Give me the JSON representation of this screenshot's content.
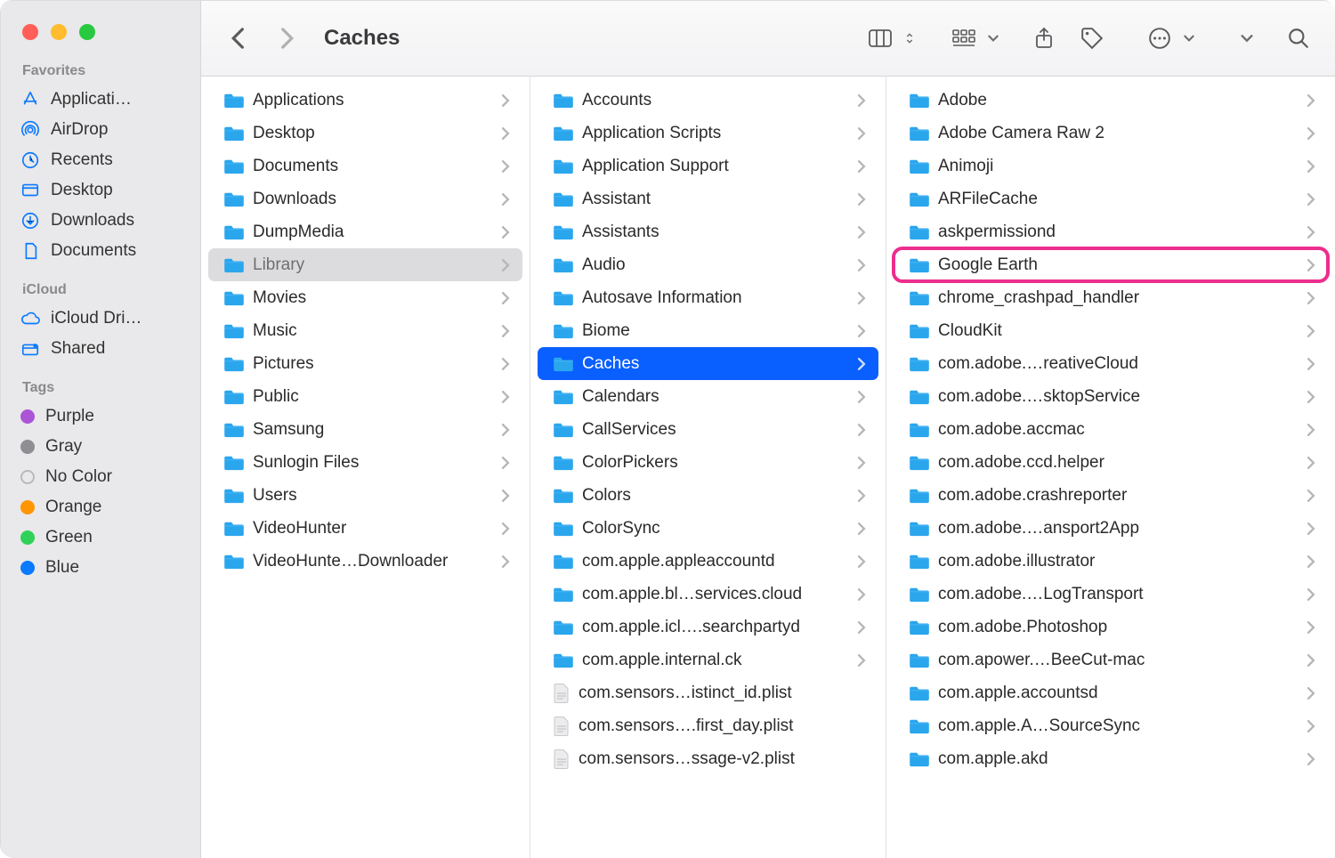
{
  "window_title": "Caches",
  "traffic_lights": [
    "close",
    "minimize",
    "zoom"
  ],
  "sidebar": {
    "sections": [
      {
        "heading": "Favorites",
        "items": [
          {
            "icon": "app-store",
            "label": "Applicati…"
          },
          {
            "icon": "airdrop",
            "label": "AirDrop"
          },
          {
            "icon": "clock",
            "label": "Recents"
          },
          {
            "icon": "desktop",
            "label": "Desktop"
          },
          {
            "icon": "download",
            "label": "Downloads"
          },
          {
            "icon": "document",
            "label": "Documents"
          }
        ]
      },
      {
        "heading": "iCloud",
        "items": [
          {
            "icon": "cloud",
            "label": "iCloud Dri…"
          },
          {
            "icon": "shared",
            "label": "Shared"
          }
        ]
      },
      {
        "heading": "Tags",
        "items": [
          {
            "tag": "#ab54d6",
            "label": "Purple"
          },
          {
            "tag": "#8e8e93",
            "label": "Gray"
          },
          {
            "tag": "none",
            "label": "No Color"
          },
          {
            "tag": "#ff9500",
            "label": "Orange"
          },
          {
            "tag": "#30d158",
            "label": "Green"
          },
          {
            "tag": "#0a7aff",
            "label": "Blue"
          }
        ]
      }
    ]
  },
  "columns": [
    {
      "items": [
        {
          "type": "folder",
          "name": "Applications"
        },
        {
          "type": "folder",
          "name": "Desktop"
        },
        {
          "type": "folder",
          "name": "Documents"
        },
        {
          "type": "folder",
          "name": "Downloads"
        },
        {
          "type": "folder",
          "name": "DumpMedia"
        },
        {
          "type": "folder",
          "name": "Library",
          "selected": "dim"
        },
        {
          "type": "folder",
          "name": "Movies"
        },
        {
          "type": "folder",
          "name": "Music"
        },
        {
          "type": "folder",
          "name": "Pictures"
        },
        {
          "type": "folder",
          "name": "Public"
        },
        {
          "type": "folder",
          "name": "Samsung"
        },
        {
          "type": "folder",
          "name": "Sunlogin Files"
        },
        {
          "type": "folder",
          "name": "Users"
        },
        {
          "type": "folder",
          "name": "VideoHunter"
        },
        {
          "type": "folder",
          "name": "VideoHunte…Downloader"
        }
      ]
    },
    {
      "items": [
        {
          "type": "folder",
          "name": "Accounts"
        },
        {
          "type": "folder",
          "name": "Application Scripts"
        },
        {
          "type": "folder",
          "name": "Application Support"
        },
        {
          "type": "folder",
          "name": "Assistant"
        },
        {
          "type": "folder",
          "name": "Assistants"
        },
        {
          "type": "folder",
          "name": "Audio"
        },
        {
          "type": "folder",
          "name": "Autosave Information"
        },
        {
          "type": "folder",
          "name": "Biome"
        },
        {
          "type": "folder",
          "name": "Caches",
          "selected": "blue"
        },
        {
          "type": "folder",
          "name": "Calendars"
        },
        {
          "type": "folder",
          "name": "CallServices"
        },
        {
          "type": "folder",
          "name": "ColorPickers"
        },
        {
          "type": "folder",
          "name": "Colors"
        },
        {
          "type": "folder",
          "name": "ColorSync"
        },
        {
          "type": "folder",
          "name": "com.apple.appleaccountd"
        },
        {
          "type": "folder",
          "name": "com.apple.bl…services.cloud"
        },
        {
          "type": "folder",
          "name": "com.apple.icl….searchpartyd"
        },
        {
          "type": "folder",
          "name": "com.apple.internal.ck"
        },
        {
          "type": "file",
          "name": "com.sensors…istinct_id.plist"
        },
        {
          "type": "file",
          "name": "com.sensors….first_day.plist"
        },
        {
          "type": "file",
          "name": "com.sensors…ssage-v2.plist"
        }
      ]
    },
    {
      "items": [
        {
          "type": "folder",
          "name": "Adobe"
        },
        {
          "type": "folder",
          "name": "Adobe Camera Raw 2"
        },
        {
          "type": "folder",
          "name": "Animoji"
        },
        {
          "type": "folder",
          "name": "ARFileCache"
        },
        {
          "type": "folder",
          "name": "askpermissiond"
        },
        {
          "type": "folder",
          "name": "Google Earth",
          "highlight": "pink"
        },
        {
          "type": "folder",
          "name": "chrome_crashpad_handler"
        },
        {
          "type": "folder",
          "name": "CloudKit"
        },
        {
          "type": "folder",
          "name": "com.adobe.…reativeCloud"
        },
        {
          "type": "folder",
          "name": "com.adobe.…sktopService"
        },
        {
          "type": "folder",
          "name": "com.adobe.accmac"
        },
        {
          "type": "folder",
          "name": "com.adobe.ccd.helper"
        },
        {
          "type": "folder",
          "name": "com.adobe.crashreporter"
        },
        {
          "type": "folder",
          "name": "com.adobe.…ansport2App"
        },
        {
          "type": "folder",
          "name": "com.adobe.illustrator"
        },
        {
          "type": "folder",
          "name": "com.adobe.…LogTransport"
        },
        {
          "type": "folder",
          "name": "com.adobe.Photoshop"
        },
        {
          "type": "folder",
          "name": "com.apower.…BeeCut-mac"
        },
        {
          "type": "folder",
          "name": "com.apple.accountsd"
        },
        {
          "type": "folder",
          "name": "com.apple.A…SourceSync"
        },
        {
          "type": "folder",
          "name": "com.apple.akd"
        }
      ]
    }
  ]
}
